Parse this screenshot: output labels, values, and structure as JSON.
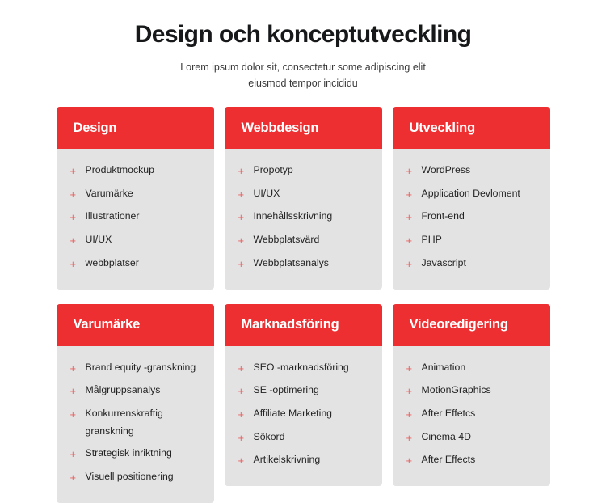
{
  "header": {
    "title": "Design och konceptutveckling",
    "subtitle_line1": "Lorem ipsum dolor sit, consectetur some adipiscing elit",
    "subtitle_line2": "eiusmod tempor incididu"
  },
  "icons": {
    "plus": "+"
  },
  "colors": {
    "accent_red": "#ED2F31",
    "card_background": "#E3E3E3",
    "plus_icon": "#E8605F",
    "page_background": "#FFFFFF",
    "title_text": "#17181A"
  },
  "cards": [
    {
      "title": "Design",
      "items": [
        "Produktmockup",
        "Varumärke",
        "Illustrationer",
        "UI/UX",
        "webbplatser"
      ]
    },
    {
      "title": "Webbdesign",
      "items": [
        "Propotyp",
        "UI/UX",
        "Innehållsskrivning",
        "Webbplatsvärd",
        "Webbplatsanalys"
      ]
    },
    {
      "title": "Utveckling",
      "items": [
        "WordPress",
        "Application Devloment",
        "Front-end",
        "PHP",
        "Javascript"
      ]
    },
    {
      "title": "Varumärke",
      "items": [
        "Brand equity -granskning",
        "Målgruppsanalys",
        "Konkurrenskraftig granskning",
        "Strategisk inriktning",
        "Visuell positionering"
      ]
    },
    {
      "title": "Marknadsföring",
      "items": [
        "SEO -marknadsföring",
        "SE -optimering",
        "Affiliate Marketing",
        "Sökord",
        "Artikelskrivning"
      ]
    },
    {
      "title": "Videoredigering",
      "items": [
        "Animation",
        "MotionGraphics",
        "After Effetcs",
        "Cinema 4D",
        "After Effects"
      ]
    }
  ]
}
